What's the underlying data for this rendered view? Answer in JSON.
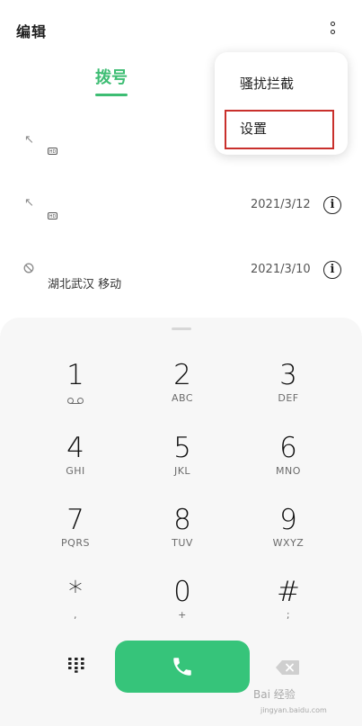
{
  "header": {
    "edit_label": "编辑"
  },
  "tabs": {
    "dial_label": "拨号"
  },
  "call_log": [
    {
      "date": "",
      "location": ""
    },
    {
      "date": "2021/3/12",
      "location": ""
    },
    {
      "date": "2021/3/10",
      "location": "湖北武汉 移动"
    }
  ],
  "menu": {
    "items": [
      "骚扰拦截",
      "设置"
    ]
  },
  "keypad": {
    "keys": [
      {
        "digit": "1",
        "sub": ""
      },
      {
        "digit": "2",
        "sub": "ABC"
      },
      {
        "digit": "3",
        "sub": "DEF"
      },
      {
        "digit": "4",
        "sub": "GHI"
      },
      {
        "digit": "5",
        "sub": "JKL"
      },
      {
        "digit": "6",
        "sub": "MNO"
      },
      {
        "digit": "7",
        "sub": "PQRS"
      },
      {
        "digit": "8",
        "sub": "TUV"
      },
      {
        "digit": "9",
        "sub": "WXYZ"
      },
      {
        "digit": "*",
        "sub": ","
      },
      {
        "digit": "0",
        "sub": "+"
      },
      {
        "digit": "#",
        "sub": ";"
      }
    ]
  },
  "watermark": {
    "text": "Bai 经验",
    "sub": "jingyan.baidu.com"
  },
  "colors": {
    "accent": "#3dbd73",
    "call_button": "#36c47a",
    "highlight_box": "#c9302c"
  },
  "icons": {
    "more": "more-vertical-icon",
    "outgoing": "outgoing-call-icon",
    "blocked": "blocked-call-icon",
    "info": "info-icon",
    "hd": "hd-badge-icon",
    "voicemail": "voicemail-icon",
    "dialpad": "dialpad-icon",
    "call": "phone-icon",
    "backspace": "backspace-icon"
  }
}
